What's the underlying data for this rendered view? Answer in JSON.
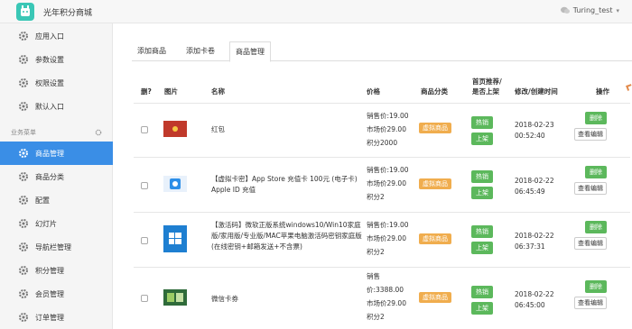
{
  "app": {
    "title": "光年积分商城",
    "user": "Turing_test"
  },
  "sidebar": {
    "top_items": [
      {
        "label": "应用入口"
      },
      {
        "label": "参数设置"
      },
      {
        "label": "权限设置"
      },
      {
        "label": "默认入口"
      }
    ],
    "section_title": "业务菜单",
    "menu_items": [
      {
        "label": "商品管理",
        "active": true
      },
      {
        "label": "商品分类"
      },
      {
        "label": "配置"
      },
      {
        "label": "幻灯片"
      },
      {
        "label": "导航栏管理"
      },
      {
        "label": "积分管理"
      },
      {
        "label": "会员管理"
      },
      {
        "label": "订单管理"
      }
    ]
  },
  "tabs": [
    {
      "label": "添加商品"
    },
    {
      "label": "添加卡卷"
    },
    {
      "label": "商品管理",
      "active": true
    }
  ],
  "table": {
    "headers": {
      "del": "删?",
      "image": "图片",
      "name": "名称",
      "price": "价格",
      "category": "商品分类",
      "recommend_l1": "首页推荐/",
      "recommend_l2": "是否上架",
      "time": "修改/创建时间",
      "action": "操作"
    },
    "rows": [
      {
        "name": "红包",
        "price_lines": [
          "销售价:19.00",
          "市场价29.00",
          "积分2000"
        ],
        "category": "虚拟商品",
        "hot": "热销",
        "shelf": "上架",
        "date": "2018-02-23",
        "time": "00:52:40",
        "delete": "删除",
        "edit": "查看编辑",
        "image_icon": "red-envelope-image"
      },
      {
        "name": "【虚拟卡密】App Store 充值卡 100元 (电子卡) Apple ID 充值",
        "price_lines": [
          "销售价:19.00",
          "市场价29.00",
          "积分2"
        ],
        "category": "虚拟商品",
        "hot": "热销",
        "shelf": "上架",
        "date": "2018-02-22",
        "time": "06:45:49",
        "delete": "删除",
        "edit": "查看编辑",
        "image_icon": "apple-card-image"
      },
      {
        "name": "【激活码】微软正版系统windows10/Win10家庭版/家用版/专业版/MAC苹果电脑激活码密钥家庭版(在线密钥+邮箱发送+不含票)",
        "price_lines": [
          "销售价:19.00",
          "市场价29.00",
          "积分2"
        ],
        "category": "虚拟商品",
        "hot": "热销",
        "shelf": "上架",
        "date": "2018-02-22",
        "time": "06:37:31",
        "delete": "删除",
        "edit": "查看编辑",
        "image_icon": "windows-image"
      },
      {
        "name": "微信卡券",
        "price_lines": [
          "销售",
          "价:3388.00",
          "市场价29.00",
          "积分2"
        ],
        "category": "虚拟商品",
        "hot": "热销",
        "shelf": "上架",
        "date": "2018-02-22",
        "time": "06:45:00",
        "delete": "删除",
        "edit": "查看编辑",
        "image_icon": "wechat-card-image"
      }
    ]
  },
  "colors": {
    "accent": "#3a8ee6",
    "category": "#f0ad4e",
    "green": "#5cb85c",
    "logo": "#3ac7b6"
  }
}
